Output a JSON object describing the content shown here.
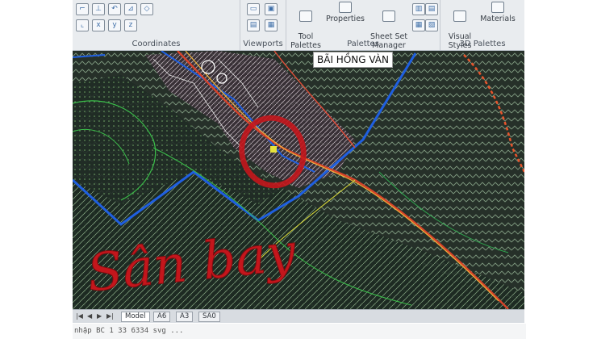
{
  "ribbon": {
    "panels": {
      "coordinates": "Coordinates",
      "viewports": "Viewports",
      "palettes": "Palettes",
      "palettes_3d": "3D Palettes"
    },
    "buttons": {
      "tool_palettes": "Tool\nPalettes",
      "properties": "Properties",
      "sheet_set_manager": "Sheet Set\nManager",
      "visual_styles": "Visual\nStyles",
      "materials": "Materials"
    }
  },
  "map": {
    "town_label": "BÃI HỒNG VÀN",
    "handwritten_note": "Sân bay"
  },
  "status": {
    "tabs": [
      "Model",
      "A6",
      "A3",
      "SA0"
    ],
    "command_text": "nhập BC 1 33 6334 svg ..."
  },
  "colors": {
    "boundary": "#1f5fe0",
    "road": "#d8432a",
    "hatch": "#8fa78e",
    "annotation": "#c4161c"
  }
}
